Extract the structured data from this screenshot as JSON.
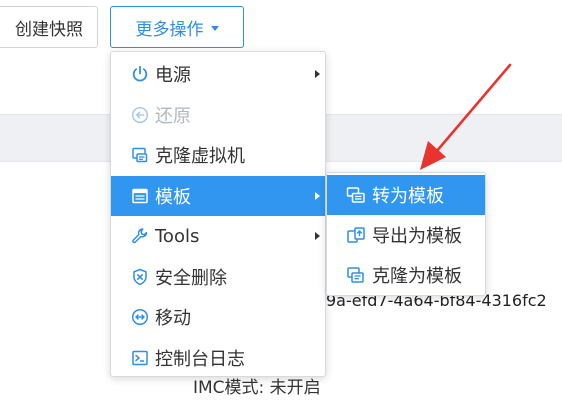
{
  "toolbar": {
    "snapshot_label": "创建快照",
    "more_label": "更多操作"
  },
  "menu": {
    "items": [
      {
        "label": "电源",
        "icon": "power-icon",
        "has_submenu": true,
        "disabled": false
      },
      {
        "label": "还原",
        "icon": "restore-icon",
        "has_submenu": false,
        "disabled": true
      },
      {
        "label": "克隆虚拟机",
        "icon": "clone-vm-icon",
        "has_submenu": false,
        "disabled": false
      },
      {
        "label": "模板",
        "icon": "template-icon",
        "has_submenu": true,
        "disabled": false,
        "active": true
      },
      {
        "label": "Tools",
        "icon": "wrench-icon",
        "has_submenu": true,
        "disabled": false
      },
      {
        "label": "安全删除",
        "icon": "shield-delete-icon",
        "has_submenu": false,
        "disabled": false
      },
      {
        "label": "移动",
        "icon": "move-icon",
        "has_submenu": false,
        "disabled": false
      },
      {
        "label": "控制台日志",
        "icon": "console-log-icon",
        "has_submenu": false,
        "disabled": false
      }
    ]
  },
  "submenu": {
    "items": [
      {
        "label": "转为模板",
        "icon": "convert-template-icon",
        "active": true
      },
      {
        "label": "导出为模板",
        "icon": "export-template-icon",
        "active": false
      },
      {
        "label": "克隆为模板",
        "icon": "clone-template-icon",
        "active": false
      }
    ]
  },
  "background": {
    "uuid_fragment": "9a-efd7-4a64-bf84-4316fc2",
    "imc_mode": "IMC模式: 未开启"
  },
  "colors": {
    "accent": "#3196f0",
    "disabled": "#b3b8bf",
    "annotation": "#e8332e"
  }
}
